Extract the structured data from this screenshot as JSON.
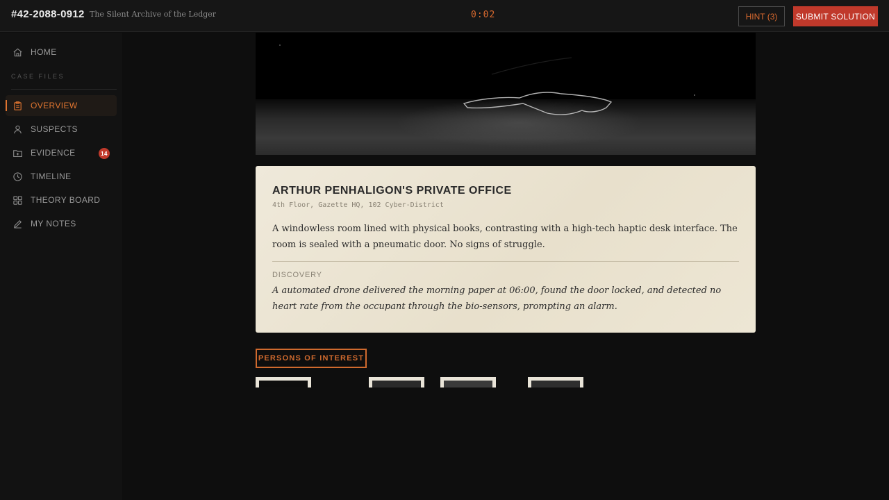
{
  "header": {
    "case_id": "#42-2088-0912",
    "case_title": "The Silent Archive of the Ledger",
    "timer": "0:02",
    "hint_label": "HINT (3)",
    "submit_label": "SUBMIT SOLUTION"
  },
  "sidebar": {
    "home_label": "HOME",
    "section_label": "CASE FILES",
    "items": [
      {
        "label": "OVERVIEW",
        "icon": "clipboard-icon",
        "active": true
      },
      {
        "label": "SUSPECTS",
        "icon": "person-icon"
      },
      {
        "label": "EVIDENCE",
        "icon": "folder-icon",
        "badge": "14"
      },
      {
        "label": "TIMELINE",
        "icon": "clock-icon"
      },
      {
        "label": "THEORY BOARD",
        "icon": "grid-icon"
      },
      {
        "label": "MY NOTES",
        "icon": "pencil-icon"
      }
    ]
  },
  "scene": {
    "icon": "crime-scene-chalk-outline"
  },
  "location": {
    "title": "ARTHUR PENHALIGON'S PRIVATE OFFICE",
    "address": "4th Floor, Gazette HQ, 102 Cyber-District",
    "description": "A windowless room lined with physical books, contrasting with a high-tech haptic desk interface. The room is sealed with a pneumatic door. No signs of struggle.",
    "discovery_label": "DISCOVERY",
    "discovery_text": "A automated drone delivered the morning paper at 06:00, found the door locked, and detected no heart rate from the occupant through the bio-sensors, prompting an alarm."
  },
  "persons": {
    "label": "PERSONS OF INTEREST"
  },
  "colors": {
    "accent": "#e07530",
    "danger": "#c0392b",
    "paper": "#efe9da",
    "background": "#0e0e0e"
  }
}
